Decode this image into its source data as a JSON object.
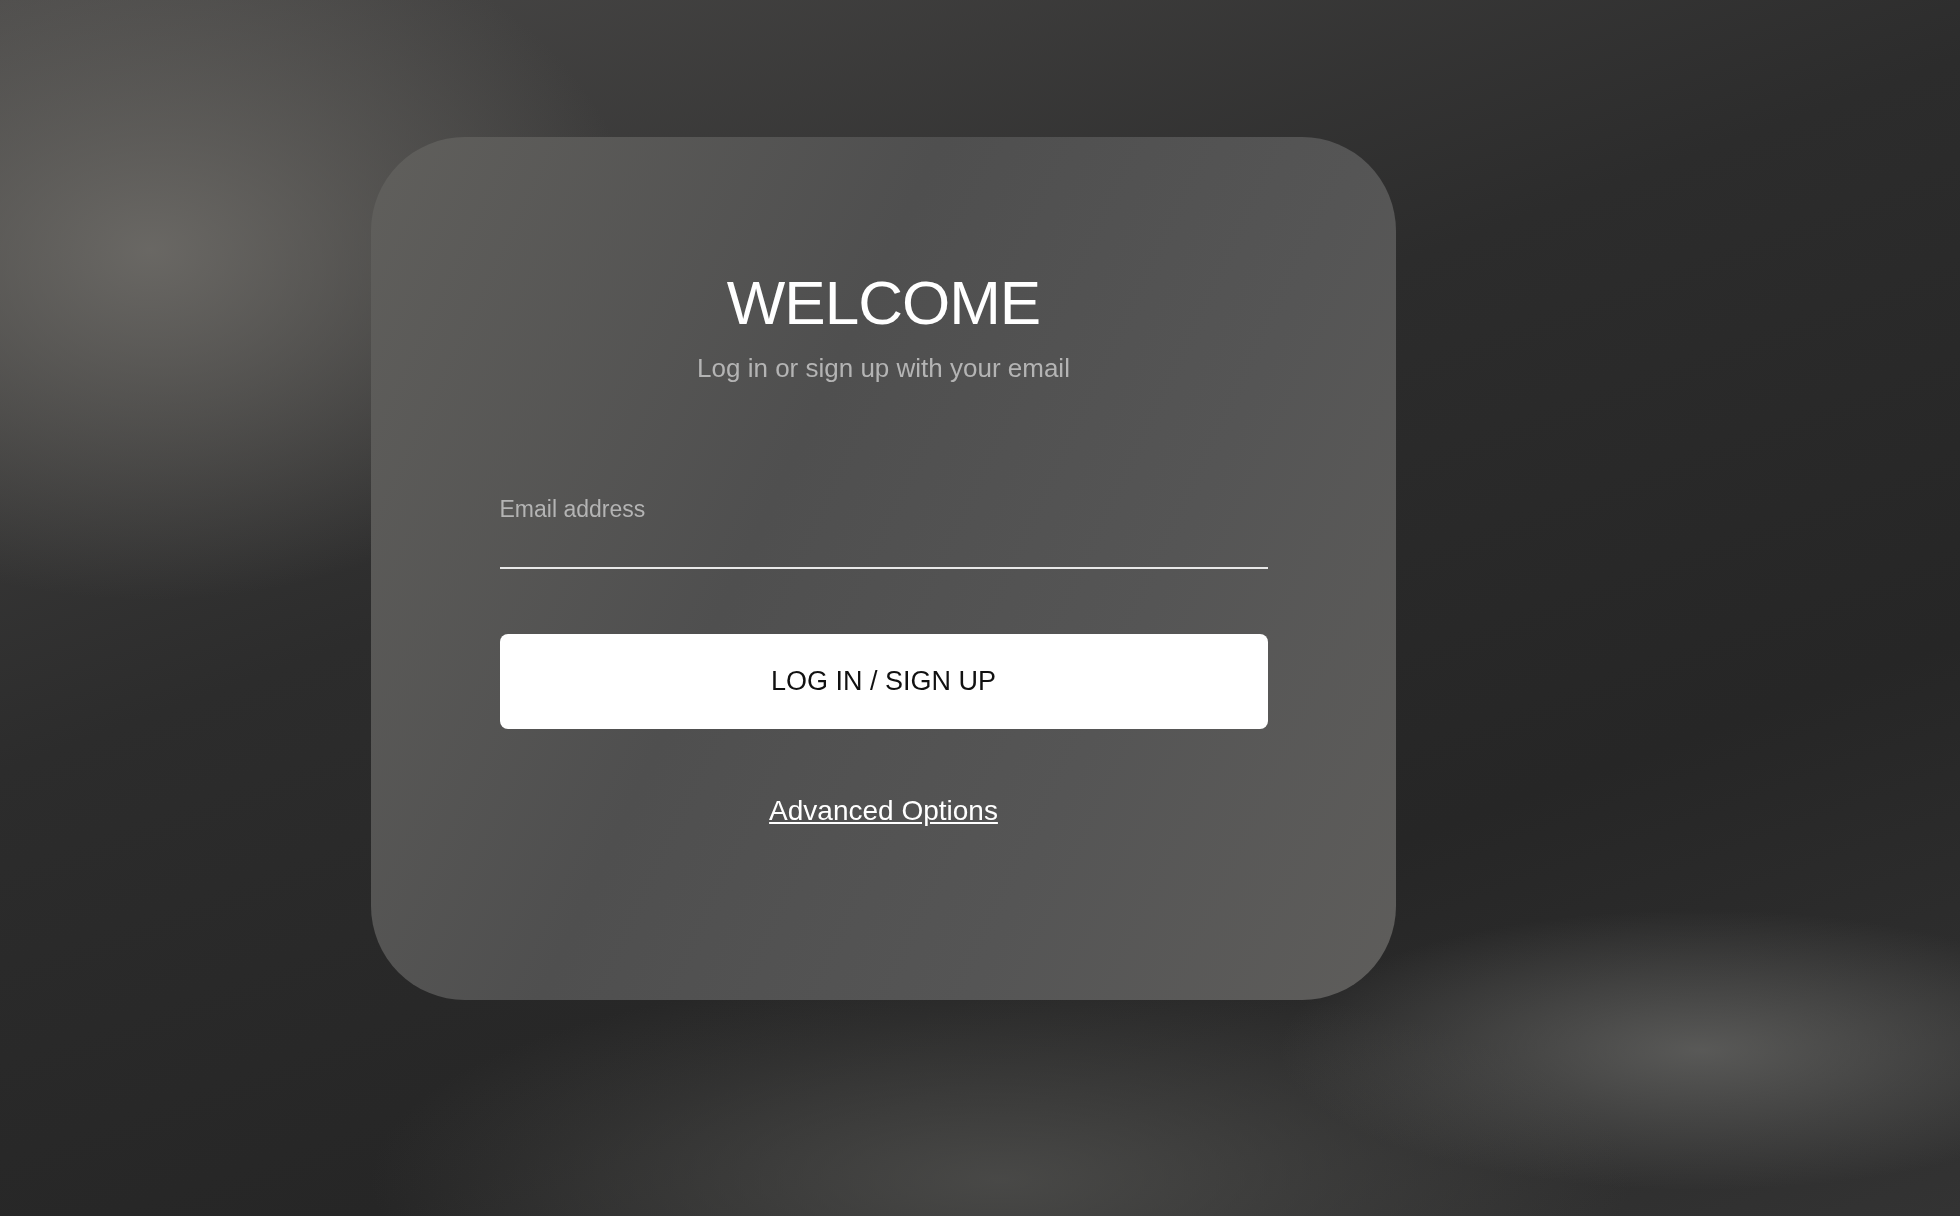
{
  "title": "WELCOME",
  "subtitle": "Log in or sign up with your email",
  "email_field": {
    "placeholder": "Email address"
  },
  "submit_button": {
    "label": "LOG IN / SIGN UP"
  },
  "advanced_link": {
    "label": "Advanced Options"
  }
}
